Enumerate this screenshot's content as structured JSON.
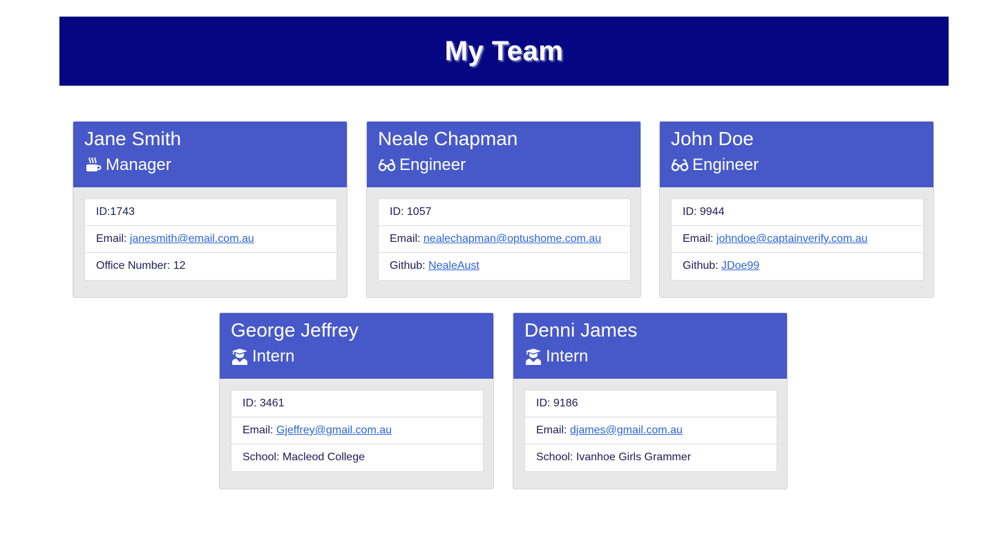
{
  "header": {
    "title": "My Team"
  },
  "colors": {
    "header_bg": "#060682",
    "card_head_bg": "#4759c8",
    "link": "#2c63d8"
  },
  "cards": [
    {
      "name": "Jane Smith",
      "role": "Manager",
      "role_icon": "coffee-icon",
      "id_label": "ID:",
      "id": "1743",
      "email_label": "Email: ",
      "email": "janesmith@email.com.au",
      "extra_label": "Office Number: ",
      "extra": "12"
    },
    {
      "name": "Neale Chapman",
      "role": "Engineer",
      "role_icon": "glasses-icon",
      "id_label": "ID: ",
      "id": "1057",
      "email_label": "Email: ",
      "email": "nealechapman@optushome.com.au",
      "extra_label": "Github: ",
      "extra": "NealeAust"
    },
    {
      "name": "John Doe",
      "role": "Engineer",
      "role_icon": "glasses-icon",
      "id_label": "ID: ",
      "id": "9944",
      "email_label": "Email: ",
      "email": "johndoe@captainverify.com.au",
      "extra_label": "Github: ",
      "extra": "JDoe99"
    },
    {
      "name": "George Jeffrey",
      "role": "Intern",
      "role_icon": "graduate-icon",
      "id_label": "ID: ",
      "id": "3461",
      "email_label": "Email: ",
      "email": "Gjeffrey@gmail.com.au",
      "extra_label": "School: ",
      "extra": "Macleod College"
    },
    {
      "name": "Denni James",
      "role": "Intern",
      "role_icon": "graduate-icon",
      "id_label": "ID: ",
      "id": "9186",
      "email_label": "Email: ",
      "email": "djames@gmail.com.au",
      "extra_label": "School: ",
      "extra": "Ivanhoe Girls Grammer"
    }
  ]
}
